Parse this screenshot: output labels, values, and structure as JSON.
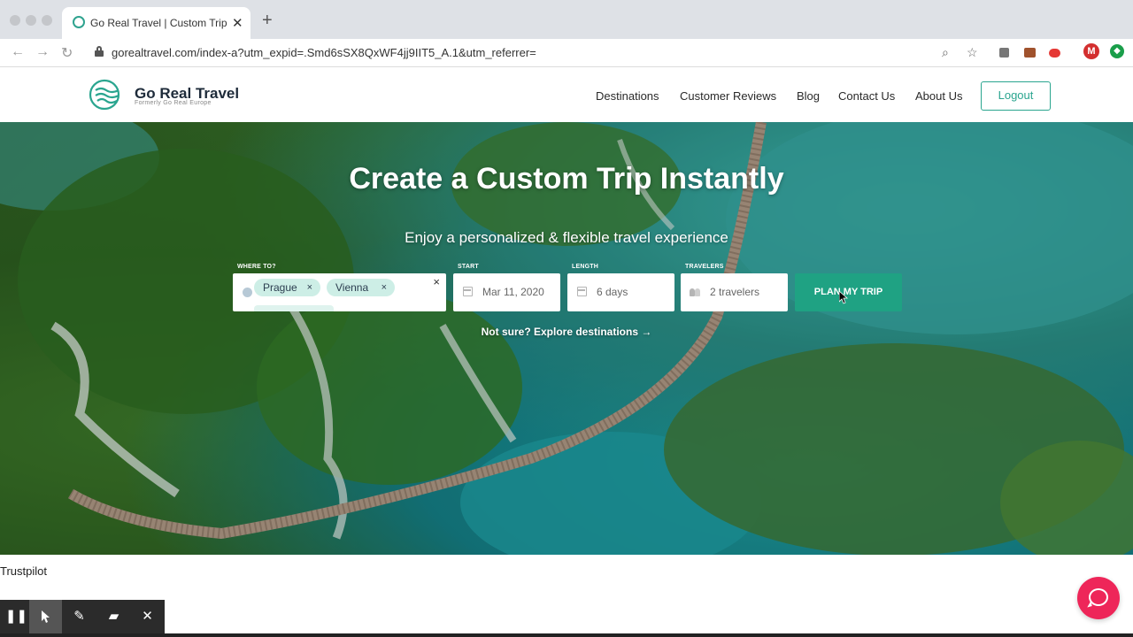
{
  "browser": {
    "tab_title": "Go Real Travel | Custom Trip Planner",
    "tab_close": "✕",
    "new_tab": "+",
    "url": "gorealtravel.com/index-a?utm_expid=.Smd6sSX8QxWF4jj9IIT5_A.1&utm_referrer=",
    "back": "←",
    "forward": "→",
    "reload": "↻",
    "zoom_icon": "⌕",
    "star_icon": "☆",
    "ext_m": "M",
    "ext_g": "◆"
  },
  "header": {
    "logo_name": "Go Real Travel",
    "logo_sub": "Formerly Go Real Europe",
    "nav": [
      "Destinations",
      "Customer Reviews",
      "Blog",
      "Contact Us",
      "About Us"
    ],
    "logout": "Logout"
  },
  "hero": {
    "title": "Create a Custom Trip Instantly",
    "subtitle": "Enjoy a personalized & flexible travel experience",
    "where_label": "WHERE TO?",
    "start_label": "START",
    "length_label": "LENGTH",
    "travelers_label": "TRAVELERS",
    "chips": [
      "Prague",
      "Vienna"
    ],
    "chip_remove": "×",
    "where_close": "×",
    "start_value": "Mar 11, 2020",
    "length_value": "6 days",
    "travelers_value": "2 travelers",
    "plan_button": "PLAN MY TRIP",
    "explore_link": "Not sure? Explore destinations →"
  },
  "footer": {
    "trustpilot": "Trustpilot"
  },
  "recorder": {
    "pause": "❚❚",
    "pointer": "➤",
    "pen": "✎",
    "highlighter": "▰",
    "close": "✕"
  },
  "colors": {
    "brand": "#2aa58f",
    "cta": "#1fa283",
    "chat": "#ee2659"
  }
}
